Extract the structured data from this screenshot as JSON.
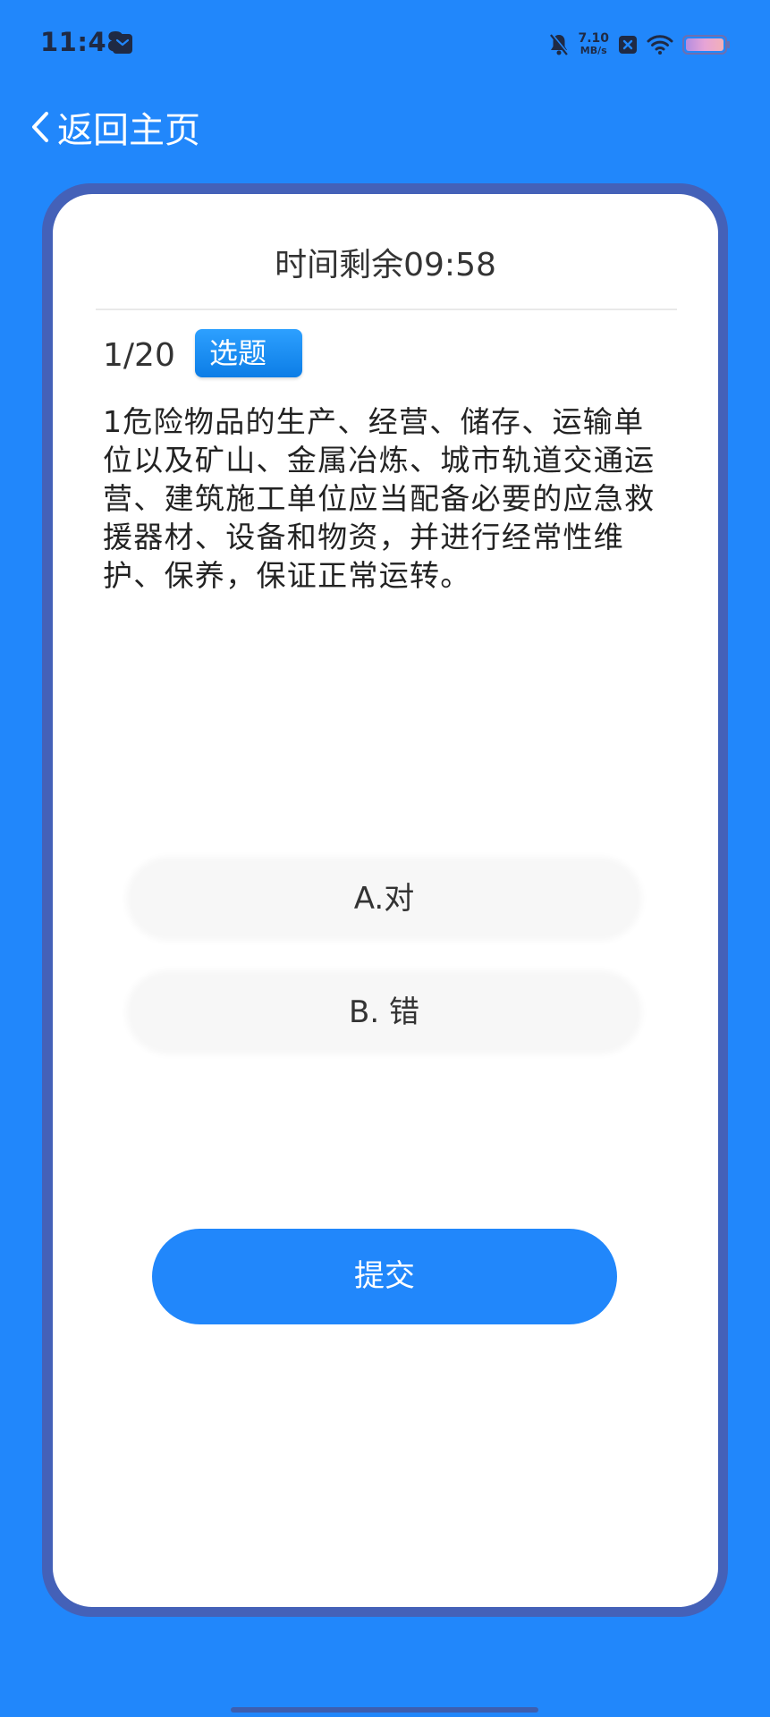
{
  "status_bar": {
    "time": "11:48",
    "net_speed_value": "7.10",
    "net_speed_unit": "MB/s",
    "icons": [
      "message-icon",
      "bell-muted-icon",
      "speed-indicator",
      "close-box-icon",
      "wifi-icon",
      "battery-icon"
    ]
  },
  "nav": {
    "back_label": "返回主页"
  },
  "quiz": {
    "timer_text": "时间剩余09:58",
    "progress": "1/20",
    "type_badge": "选题",
    "question": "1危险物品的生产、经营、储存、运输单位以及矿山、金属冶炼、城市轨道交通运营、建筑施工单位应当配备必要的应急救援器材、设备和物资，并进行经常性维护、保养，保证正常运转。",
    "options": [
      {
        "label": "A.对"
      },
      {
        "label": "B. 错"
      }
    ],
    "submit_label": "提交"
  },
  "colors": {
    "background": "#2187fb",
    "card_border": "#4461b8",
    "badge": "#1c8ff5"
  }
}
